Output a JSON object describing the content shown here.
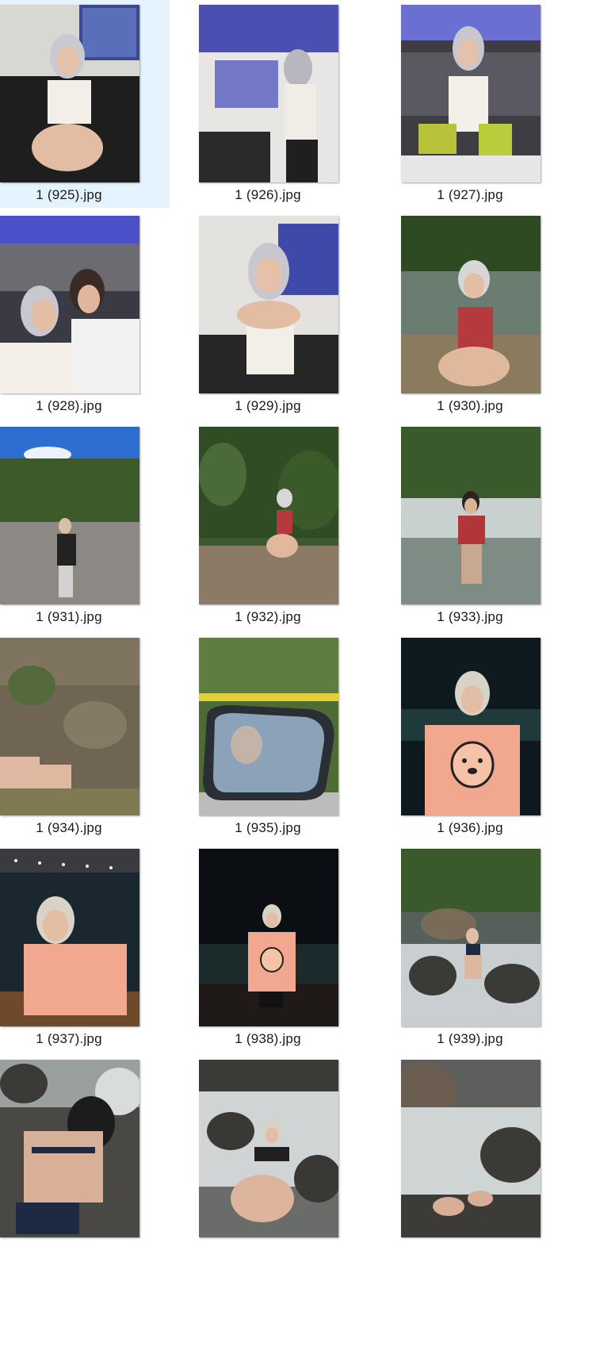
{
  "files": [
    {
      "name": "1 (925).jpg",
      "selected": true
    },
    {
      "name": "1 (926).jpg",
      "selected": false
    },
    {
      "name": "1 (927).jpg",
      "selected": false
    },
    {
      "name": "1 (928).jpg",
      "selected": false
    },
    {
      "name": "1 (929).jpg",
      "selected": false
    },
    {
      "name": "1 (930).jpg",
      "selected": false
    },
    {
      "name": "1 (931).jpg",
      "selected": false
    },
    {
      "name": "1 (932).jpg",
      "selected": false
    },
    {
      "name": "1 (933).jpg",
      "selected": false
    },
    {
      "name": "1 (934).jpg",
      "selected": false
    },
    {
      "name": "1 (935).jpg",
      "selected": false
    },
    {
      "name": "1 (936).jpg",
      "selected": false
    },
    {
      "name": "1 (937).jpg",
      "selected": false
    },
    {
      "name": "1 (938).jpg",
      "selected": false
    },
    {
      "name": "1 (939).jpg",
      "selected": false
    },
    {
      "name": "",
      "selected": false
    },
    {
      "name": "",
      "selected": false
    },
    {
      "name": "",
      "selected": false
    }
  ],
  "colors": {
    "selection": "#e5f3ff",
    "caption_text": "#1a1a1a"
  }
}
